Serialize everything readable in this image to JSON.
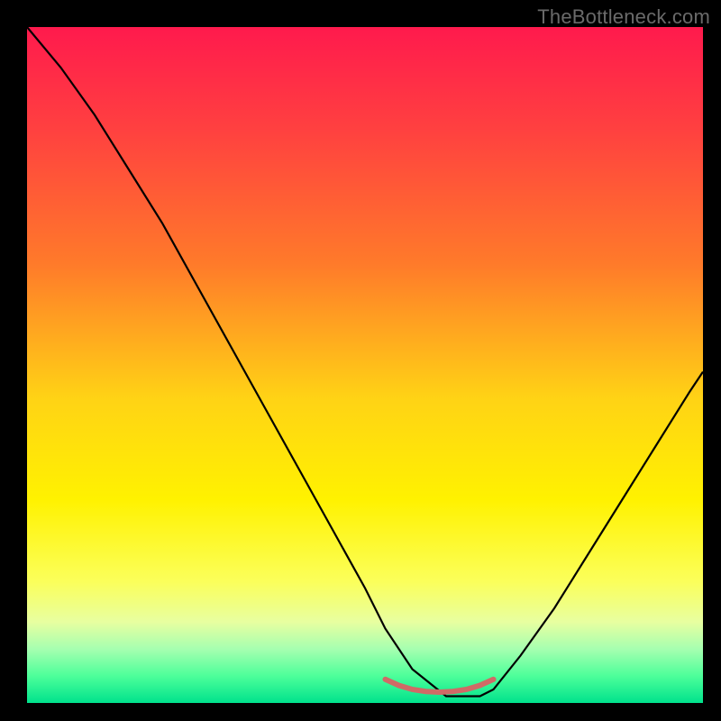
{
  "watermark": "TheBottleneck.com",
  "chart_data": {
    "type": "line",
    "title": "",
    "xlabel": "",
    "ylabel": "",
    "xlim": [
      0,
      100
    ],
    "ylim": [
      0,
      100
    ],
    "background": {
      "type": "vertical-gradient",
      "stops": [
        {
          "pos": 0.0,
          "color": "#ff1a4d"
        },
        {
          "pos": 0.15,
          "color": "#ff4040"
        },
        {
          "pos": 0.35,
          "color": "#ff7a2a"
        },
        {
          "pos": 0.55,
          "color": "#ffd315"
        },
        {
          "pos": 0.7,
          "color": "#fff200"
        },
        {
          "pos": 0.82,
          "color": "#fbff5a"
        },
        {
          "pos": 0.88,
          "color": "#e8ffa0"
        },
        {
          "pos": 0.92,
          "color": "#a6ffb0"
        },
        {
          "pos": 0.96,
          "color": "#4dff9a"
        },
        {
          "pos": 1.0,
          "color": "#00e28c"
        }
      ]
    },
    "series": [
      {
        "name": "curve",
        "stroke": "#000000",
        "x": [
          0,
          5,
          10,
          15,
          20,
          25,
          30,
          35,
          40,
          45,
          50,
          53,
          57,
          62,
          67,
          69,
          73,
          78,
          83,
          88,
          93,
          98,
          100
        ],
        "y": [
          100,
          94,
          87,
          79,
          71,
          62,
          53,
          44,
          35,
          26,
          17,
          11,
          5,
          1,
          1,
          2,
          7,
          14,
          22,
          30,
          38,
          46,
          49
        ]
      },
      {
        "name": "highlight-band",
        "stroke": "#d06a66",
        "thickness": 6,
        "x": [
          53,
          55,
          57,
          59,
          61,
          63,
          65,
          67,
          69
        ],
        "y": [
          3.5,
          2.6,
          2.0,
          1.7,
          1.6,
          1.7,
          2.0,
          2.6,
          3.5
        ]
      }
    ],
    "annotations": []
  }
}
